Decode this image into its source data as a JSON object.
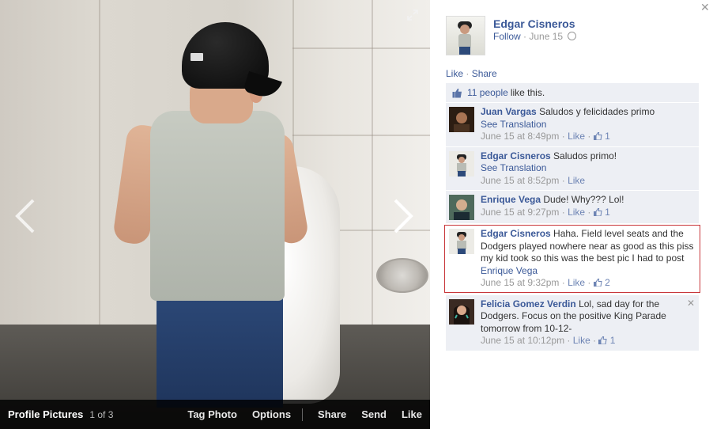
{
  "photo_bar": {
    "album": "Profile Pictures",
    "count": "1 of 3",
    "actions": [
      "Tag Photo",
      "Options",
      "Share",
      "Send",
      "Like"
    ]
  },
  "author": {
    "name": "Edgar Cisneros",
    "follow": "Follow",
    "separator": " · ",
    "date": "June 15"
  },
  "post_actions": {
    "like": "Like",
    "separator": " · ",
    "share": "Share"
  },
  "likes": {
    "count_text": "11 people",
    "suffix": "like this."
  },
  "comments": [
    {
      "name": "Juan Vargas",
      "text": "Saludos y felicidades primo",
      "translation": "See Translation",
      "time": "June 15 at 8:49pm",
      "like": "Like",
      "likes": "1",
      "highlight": false
    },
    {
      "name": "Edgar Cisneros",
      "text": "Saludos primo!",
      "translation": "See Translation",
      "time": "June 15 at 8:52pm",
      "like": "Like",
      "likes": "",
      "highlight": false
    },
    {
      "name": "Enrique Vega",
      "text": "Dude! Why??? Lol!",
      "translation": "",
      "time": "June 15 at 9:27pm",
      "like": "Like",
      "likes": "1",
      "highlight": false
    },
    {
      "name": "Edgar Cisneros",
      "text": "Haha. Field level seats and the Dodgers played nowhere near as good as this piss my kid took so this was the best pic I had to post",
      "mention": "Enrique Vega",
      "translation": "",
      "time": "June 15 at 9:32pm",
      "like": "Like",
      "likes": "2",
      "highlight": true
    },
    {
      "name": "Felicia Gomez Verdin",
      "text": "Lol, sad day for the Dodgers. Focus on the positive King Parade tomorrow from 10-12-",
      "translation": "",
      "time": "June 15 at 10:12pm",
      "like": "Like",
      "likes": "1",
      "highlight": false
    }
  ],
  "meta_separator": " · ",
  "colors": {
    "link": "#3b5998",
    "ufi_bg": "#edeff4",
    "highlight_border": "#c8363a"
  },
  "icons": [
    "expand-icon",
    "close-icon",
    "chevron-left-icon",
    "chevron-right-icon",
    "globe-icon",
    "thumbs-up-icon",
    "remove-comment-icon"
  ]
}
